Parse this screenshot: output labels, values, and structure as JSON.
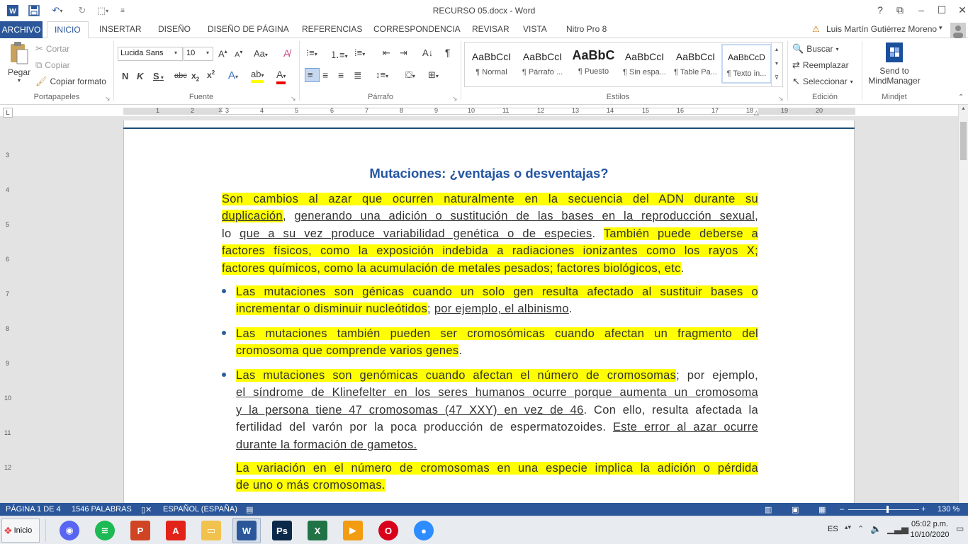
{
  "window": {
    "title": "RECURSO 05.docx - Word",
    "controls": [
      "?",
      "⧉",
      "–",
      "☐",
      "✕"
    ]
  },
  "tabs": {
    "file": "ARCHIVO",
    "items": [
      "INICIO",
      "INSERTAR",
      "DISEÑO",
      "DISEÑO DE PÁGINA",
      "REFERENCIAS",
      "CORRESPONDENCIA",
      "REVISAR",
      "VISTA",
      "Nitro Pro 8"
    ],
    "active": "INICIO",
    "user": "Luis Martín Gutiérrez Moreno"
  },
  "ribbon": {
    "clipboard": {
      "label": "Portapapeles",
      "paste": "Pegar",
      "cut": "Cortar",
      "copy": "Copiar",
      "format_painter": "Copiar formato"
    },
    "font": {
      "label": "Fuente",
      "family": "Lucida Sans",
      "size": "10"
    },
    "paragraph": {
      "label": "Párrafo"
    },
    "styles": {
      "label": "Estilos",
      "items": [
        {
          "sample": "AaBbCcI",
          "name": "¶ Normal"
        },
        {
          "sample": "AaBbCcI",
          "name": "¶ Párrafo ..."
        },
        {
          "sample": "AaBbC",
          "name": "¶ Puesto"
        },
        {
          "sample": "AaBbCcI",
          "name": "¶ Sin espa..."
        },
        {
          "sample": "AaBbCcI",
          "name": "¶ Table Pa..."
        },
        {
          "sample": "AaBbCcD",
          "name": "¶ Texto in..."
        }
      ]
    },
    "editing": {
      "label": "Edición",
      "find": "Buscar",
      "replace": "Reemplazar",
      "select": "Seleccionar"
    },
    "mindjet": {
      "label": "Mindjet",
      "send1": "Send to",
      "send2": "MindManager"
    }
  },
  "ruler": {
    "h": [
      "1",
      "2",
      "3",
      "4",
      "5",
      "6",
      "7",
      "8",
      "9",
      "10",
      "11",
      "12",
      "13",
      "14",
      "15",
      "16",
      "17",
      "18",
      "19",
      "20"
    ],
    "v": [
      "3",
      "4",
      "5",
      "6",
      "7",
      "8",
      "9",
      "10",
      "11",
      "12"
    ]
  },
  "document": {
    "heading": "Mutaciones: ¿ventajas o desventajas?",
    "p1": {
      "l1": "Son cambios al azar que ocurren naturalmente  en la secuencia del ADN durante su",
      "l2a": "duplicación",
      "l2b": ", ",
      "l2c": "generando una adición o sustitución de las bases en la reproducción sexual",
      "l2d": ",",
      "l3a": "lo ",
      "l3b": "que a su vez produce variabilidad genética o de especies",
      "l3c": ". ",
      "l3d": "También puede deberse a",
      "l4": "factores físicos, como la exposición indebida a radiaciones ionizantes como los rayos X;",
      "l5a": "factores químicos, como la acumulación de metales pesados; factores biológicos, etc",
      "l5b": "."
    },
    "b1": {
      "l1": "Las mutaciones son génicas cuando un solo gen resulta afectado al sustituir bases o",
      "l2a": "incrementar o disminuir nucleótidos",
      "l2b": "; ",
      "l2c": "por ejemplo, el albinismo",
      "l2d": "."
    },
    "b2": {
      "l1": "Las mutaciones también pueden ser cromosómicas  cuando afectan un fragmento del",
      "l2a": "cromosoma que comprende varios genes",
      "l2b": "."
    },
    "b3": {
      "l1a": "Las mutaciones son genómicas cuando afectan el número de cromosomas",
      "l1b": "; por ejemplo,",
      "l2": "el síndrome de Klinefelter en los seres humanos ocurre porque aumenta un cromosoma",
      "l3a": "y la persona tiene 47 cromosomas (47 XXY) en vez de 46",
      "l3b": ". Con ello, resulta afectada la",
      "l4": "fertilidad del varón por la poca producción de espermatozoides. ",
      "l4b": "Este error al azar ocurre",
      "l5": "durante la formación de gametos."
    },
    "p2": {
      "l1": "La variación en el número de cromosomas  en una especie implica la adición o pérdida",
      "l2": "de uno o más cromosomas."
    }
  },
  "status": {
    "page": "PÁGINA 1 DE 4",
    "words": "1546 PALABRAS",
    "language": "ESPAÑOL (ESPAÑA)",
    "zoom": "130 %",
    "zoom_level": 130
  },
  "taskbar": {
    "start": "Inicio",
    "lang": "ES",
    "time": "05:02 p.m.",
    "date": "10/10/2020",
    "apps": [
      {
        "name": "discord",
        "color": "#5865f2",
        "glyph": "◉"
      },
      {
        "name": "spotify",
        "color": "#1db954",
        "glyph": "≋"
      },
      {
        "name": "powerpoint",
        "color": "#d04423",
        "glyph": "P"
      },
      {
        "name": "acrobat",
        "color": "#e2231a",
        "glyph": "A"
      },
      {
        "name": "explorer",
        "color": "#f2c24f",
        "glyph": "▭"
      },
      {
        "name": "word",
        "color": "#2b579a",
        "glyph": "W"
      },
      {
        "name": "photoshop",
        "color": "#0b2a4a",
        "glyph": "Ps"
      },
      {
        "name": "excel",
        "color": "#217346",
        "glyph": "X"
      },
      {
        "name": "media",
        "color": "#f39c12",
        "glyph": "▶"
      },
      {
        "name": "opera",
        "color": "#d9001b",
        "glyph": "O"
      },
      {
        "name": "zoom",
        "color": "#2d8cff",
        "glyph": "●"
      }
    ]
  }
}
